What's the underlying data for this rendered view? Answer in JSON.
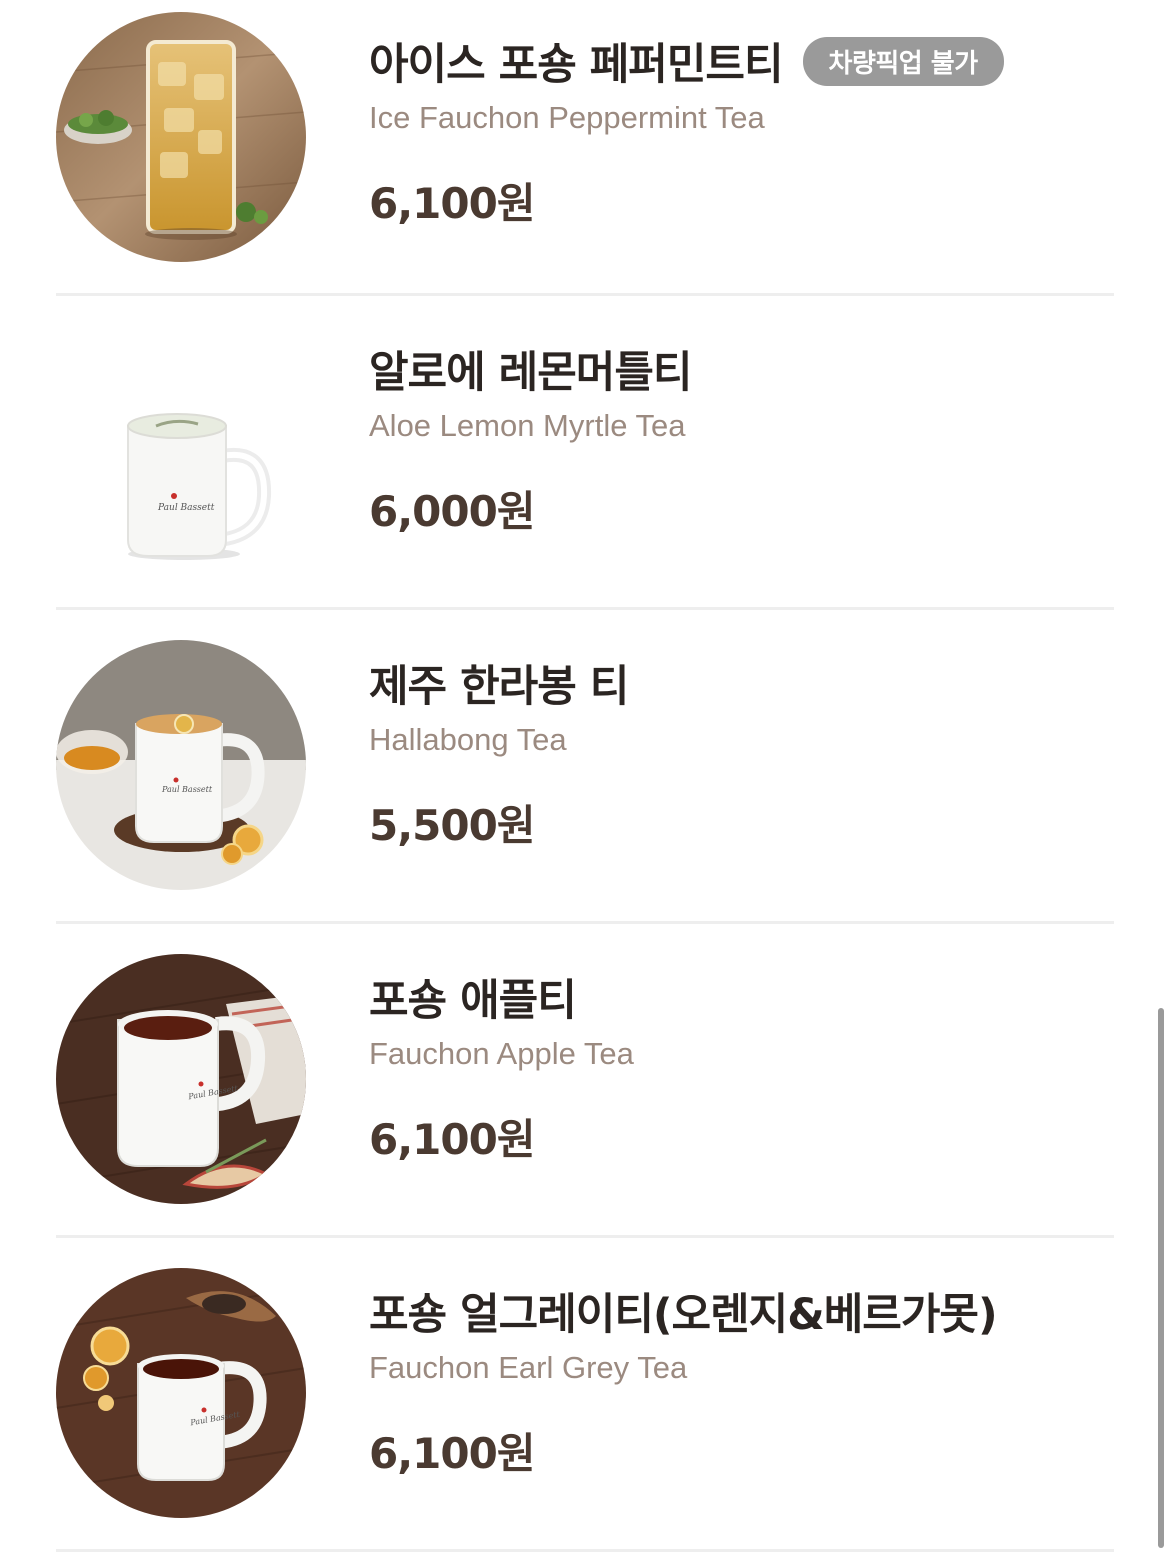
{
  "menu": {
    "items": [
      {
        "name": "아이스 포숑 페퍼민트티",
        "badge": "차량픽업 불가",
        "eng_name": "Ice Fauchon Peppermint Tea",
        "price": "6,100원",
        "image_icon": "iced-tea-glass"
      },
      {
        "name": "알로에 레몬머틀티",
        "eng_name": "Aloe Lemon Myrtle Tea",
        "price": "6,000원",
        "image_icon": "white-mug"
      },
      {
        "name": "제주 한라봉 티",
        "eng_name": "Hallabong Tea",
        "price": "5,500원",
        "image_icon": "citrus-tea-mug"
      },
      {
        "name": "포숑 애플티",
        "eng_name": "Fauchon Apple Tea",
        "price": "6,100원",
        "image_icon": "apple-tea-mug"
      },
      {
        "name": "포숑 얼그레이티(오렌지&베르가못)",
        "eng_name": "Fauchon Earl Grey Tea",
        "price": "6,100원",
        "image_icon": "earl-grey-mug"
      }
    ]
  },
  "colors": {
    "name": "#2b2522",
    "eng_name": "#9b8a80",
    "price": "#4a3a31",
    "badge_bg": "#9a9a9a",
    "divider": "#eeeeee"
  }
}
